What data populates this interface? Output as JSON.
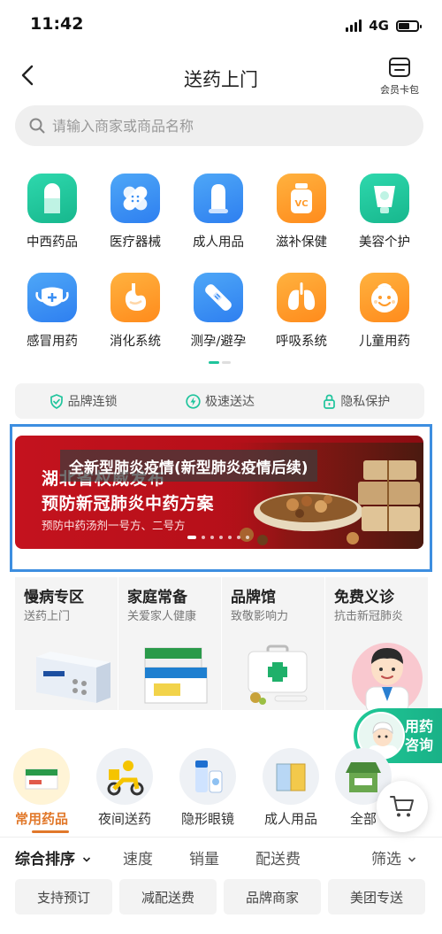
{
  "status": {
    "time": "11:42",
    "network": "4G"
  },
  "nav": {
    "title": "送药上门",
    "member_label": "会员卡包"
  },
  "search": {
    "placeholder": "请输入商家或商品名称"
  },
  "categories": [
    {
      "label": "中西药品",
      "icon": "capsule-icon",
      "color": "#1fc49c"
    },
    {
      "label": "医疗器械",
      "icon": "bandage-icon",
      "color": "#3a8ff3"
    },
    {
      "label": "成人用品",
      "icon": "condom-icon",
      "color": "#3a8ff3"
    },
    {
      "label": "滋补保健",
      "icon": "vitamin-bottle-icon",
      "color": "#ff9b2b"
    },
    {
      "label": "美容个护",
      "icon": "cream-tube-icon",
      "color": "#1fc49c"
    },
    {
      "label": "感冒用药",
      "icon": "mask-icon",
      "color": "#3a8ff3"
    },
    {
      "label": "消化系统",
      "icon": "stomach-icon",
      "color": "#ff9b2b"
    },
    {
      "label": "测孕/避孕",
      "icon": "pregnancy-test-icon",
      "color": "#3a8ff3"
    },
    {
      "label": "呼吸系统",
      "icon": "lungs-icon",
      "color": "#ff9b2b"
    },
    {
      "label": "儿童用药",
      "icon": "child-face-icon",
      "color": "#ff9b2b"
    }
  ],
  "features": [
    {
      "label": "品牌连锁",
      "icon": "shield-check-icon"
    },
    {
      "label": "极速送达",
      "icon": "lightning-icon"
    },
    {
      "label": "隐私保护",
      "icon": "lock-icon"
    }
  ],
  "banner": {
    "overlay_title": "全新型肺炎疫情(新型肺炎疫情后续)",
    "headline": "湖北省权威发布",
    "main": "预防新冠肺炎中药方案",
    "sub": "预防中药汤剂一号方、二号方",
    "accent": "#c4121e"
  },
  "promos": [
    {
      "title": "慢病专区",
      "sub": "送药上门"
    },
    {
      "title": "家庭常备",
      "sub": "关爱家人健康"
    },
    {
      "title": "品牌馆",
      "sub": "致敬影响力"
    },
    {
      "title": "免费义诊",
      "sub": "抗击新冠肺炎"
    }
  ],
  "consult": {
    "line1": "用药",
    "line2": "咨询"
  },
  "product_tabs": [
    {
      "label": "常用药品",
      "active": true
    },
    {
      "label": "夜间送药",
      "active": false
    },
    {
      "label": "隐形眼镜",
      "active": false
    },
    {
      "label": "成人用品",
      "active": false
    },
    {
      "label": "全部",
      "active": false
    }
  ],
  "sort": {
    "items": [
      "综合排序",
      "速度",
      "销量",
      "配送费"
    ],
    "filter": "筛选"
  },
  "chips": [
    "支持预订",
    "减配送费",
    "品牌商家",
    "美团专送"
  ],
  "colors": {
    "brand_green": "#1fc49c",
    "active_orange": "#e1782a",
    "highlight_frame": "#3d8ee0"
  }
}
